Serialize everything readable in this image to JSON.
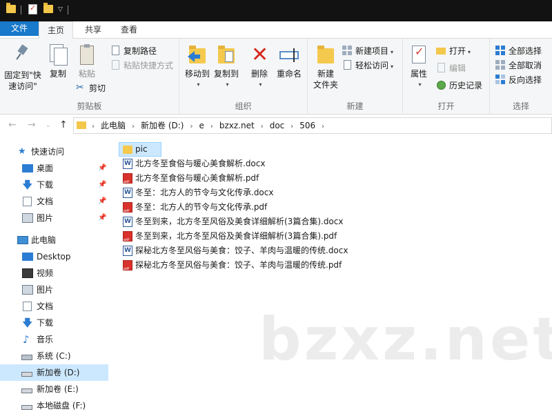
{
  "ribbon_tabs": [
    "文件",
    "主页",
    "共享",
    "查看"
  ],
  "groups": {
    "clipboard": {
      "label": "剪贴板",
      "pin_label": "固定到\"快\n速访问\"",
      "copy_label": "复制",
      "paste_label": "粘贴",
      "copy_path_label": "复制路径",
      "paste_shortcut_label": "粘贴快捷方式",
      "cut_label": "剪切"
    },
    "organize": {
      "label": "组织",
      "move_to_label": "移动到",
      "copy_to_label": "复制到",
      "delete_label": "删除",
      "rename_label": "重命名"
    },
    "new": {
      "label": "新建",
      "new_folder_label": "新建\n文件夹",
      "new_item_label": "新建项目",
      "easy_access_label": "轻松访问"
    },
    "open": {
      "label": "打开",
      "properties_label": "属性",
      "open_label": "打开",
      "edit_label": "编辑",
      "history_label": "历史记录"
    },
    "select": {
      "label": "选择",
      "select_all_label": "全部选择",
      "select_none_label": "全部取消",
      "invert_label": "反向选择"
    }
  },
  "address": {
    "crumbs": [
      "此电脑",
      "新加卷 (D:)",
      "e",
      "bzxz.net",
      "doc",
      "506"
    ]
  },
  "navpane": {
    "quick_access": "快速访问",
    "quick_items": [
      "桌面",
      "下载",
      "文档",
      "图片"
    ],
    "this_pc": "此电脑",
    "pc_items": [
      "Desktop",
      "视频",
      "图片",
      "文档",
      "下载",
      "音乐",
      "系统 (C:)",
      "新加卷 (D:)",
      "新加卷 (E:)",
      "本地磁盘 (F:)"
    ]
  },
  "files": [
    {
      "name": "pic",
      "type": "folder"
    },
    {
      "name": "北方冬至食俗与暖心美食解析.docx",
      "type": "docx"
    },
    {
      "name": "北方冬至食俗与暖心美食解析.pdf",
      "type": "pdf"
    },
    {
      "name": "冬至：北方人的节令与文化传承.docx",
      "type": "docx"
    },
    {
      "name": "冬至：北方人的节令与文化传承.pdf",
      "type": "pdf"
    },
    {
      "name": "冬至到来，北方冬至风俗及美食详细解析(3篇合集).docx",
      "type": "docx"
    },
    {
      "name": "冬至到来，北方冬至风俗及美食详细解析(3篇合集).pdf",
      "type": "pdf"
    },
    {
      "name": "探秘北方冬至风俗与美食：饺子、羊肉与温暖的传统.docx",
      "type": "docx"
    },
    {
      "name": "探秘北方冬至风俗与美食：饺子、羊肉与温暖的传统.pdf",
      "type": "pdf"
    }
  ],
  "watermark": "bzxz.net",
  "colors": {
    "accent": "#1979ca",
    "selection": "#cce8ff",
    "folder": "#f4c94d",
    "pdf": "#d9312b",
    "word": "#2b5797"
  }
}
